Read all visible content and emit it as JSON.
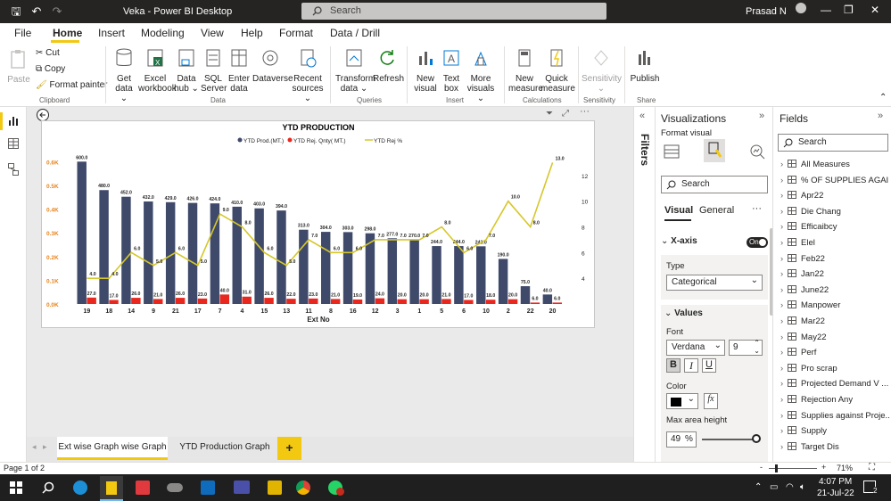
{
  "titlebar": {
    "app_title": "Veka - Power BI Desktop",
    "search_placeholder": "Search",
    "user": "Prasad N"
  },
  "menu": {
    "items": [
      "File",
      "Home",
      "Insert",
      "Modeling",
      "View",
      "Help",
      "Format",
      "Data / Drill"
    ]
  },
  "ribbon": {
    "clipboard": {
      "paste": "Paste",
      "cut": "Cut",
      "copy": "Copy",
      "format_painter": "Format painter",
      "label": "Clipboard"
    },
    "data": {
      "get_data": [
        "Get",
        "data ⌄"
      ],
      "excel": [
        "Excel",
        "workbook"
      ],
      "data_hub": [
        "Data",
        "hub ⌄"
      ],
      "sql": [
        "SQL",
        "Server"
      ],
      "enter": [
        "Enter",
        "data"
      ],
      "dataverse": [
        "Dataverse",
        ""
      ],
      "recent": [
        "Recent",
        "sources ⌄"
      ],
      "label": "Data"
    },
    "queries": {
      "transform": [
        "Transform",
        "data ⌄"
      ],
      "refresh": [
        "Refresh",
        ""
      ],
      "label": "Queries"
    },
    "insert": {
      "new_visual": [
        "New",
        "visual"
      ],
      "text_box": [
        "Text",
        "box"
      ],
      "more_visuals": [
        "More",
        "visuals ⌄"
      ],
      "label": "Insert"
    },
    "calculations": {
      "new_measure": [
        "New",
        "measure"
      ],
      "quick_measure": [
        "Quick",
        "measure"
      ],
      "label": "Calculations"
    },
    "sensitivity": {
      "btn": [
        "Sensitivity",
        "⌄"
      ],
      "label": "Sensitivity"
    },
    "share": {
      "publish": [
        "Publish",
        ""
      ],
      "label": "Share"
    }
  },
  "filters_label": "Filters",
  "viz": {
    "title": "Visualizations",
    "format_visual": "Format visual",
    "search_placeholder": "Search",
    "tab_visual": "Visual",
    "tab_general": "General",
    "more": "···",
    "xaxis": "X-axis",
    "toggle": "On",
    "type_label": "Type",
    "type_value": "Categorical",
    "values_label": "Values",
    "font_label": "Font",
    "font_value": "Verdana",
    "font_size": "9",
    "bold": "B",
    "italic": "I",
    "underline": "U",
    "color_label": "Color",
    "fx": "fx",
    "max_area_label": "Max area height",
    "max_area_value": "49",
    "max_area_unit": "%",
    "max_area_level": 0.49
  },
  "fields": {
    "title": "Fields",
    "search_placeholder": "Search",
    "items": [
      "All Measures",
      "% OF SUPPLIES AGAI...",
      "Apr22",
      "Die Chang",
      "Efficaibcy",
      "Elel",
      "Feb22",
      "Jan22",
      "June22",
      "Manpower",
      "Mar22",
      "May22",
      "Perf",
      "Pro scrap",
      "Projected Demand V ...",
      "Rejection Any",
      "Supplies against Proje...",
      "Supply",
      "Target Dis"
    ]
  },
  "tabs": {
    "items": [
      "Ext wise Graph wise Graph",
      "YTD Production Graph"
    ],
    "add": "+"
  },
  "status": {
    "page": "Page 1 of 2",
    "zoom": "71%",
    "minus": "-",
    "plus": "+"
  },
  "taskbar": {
    "time": "4:07 PM",
    "date": "21-Jul-22",
    "notif": "2"
  },
  "colors": {
    "bar_prod": "#3f4a6b",
    "bar_rej": "#e8281f",
    "line": "#d6c72a",
    "accent": "#f2c811",
    "left_axis": "#e8821c"
  },
  "chart_data": {
    "type": "bar",
    "title": "YTD PRODUCTION",
    "xlabel": "Ext No",
    "legend": [
      "YTD Prod.(MT.)",
      "YTD Rej. Qnty( MT.)",
      "YTD Rej %"
    ],
    "legend_position": "top-center",
    "categories": [
      "19",
      "18",
      "14",
      "9",
      "21",
      "17",
      "7",
      "4",
      "15",
      "13",
      "11",
      "8",
      "16",
      "12",
      "3",
      "1",
      "5",
      "6",
      "10",
      "2",
      "22",
      "20"
    ],
    "series": [
      {
        "name": "YTD Prod.(MT.)",
        "values": [
          600,
          480,
          452,
          432,
          429,
          426,
          424,
          410,
          403,
          394,
          313,
          304,
          303,
          298,
          277,
          270,
          244,
          244,
          243,
          190,
          75,
          40
        ],
        "labels": [
          "600.0",
          "480.0",
          "452.0",
          "432.0",
          "429.0",
          "426.0",
          "424.0",
          "410.0",
          "403.0",
          "394.0",
          "313.0",
          "304.0",
          "303.0",
          "298.0",
          "277.0",
          "270.0",
          "244.0",
          "244.0",
          "243.0",
          "190.0",
          "75.0",
          "40.0"
        ]
      },
      {
        "name": "YTD Rej. Qnty( MT.)",
        "values": [
          27,
          17,
          26,
          21,
          26,
          23,
          40,
          31,
          26,
          22,
          23,
          21,
          19,
          24,
          20,
          20,
          21,
          17,
          18,
          20,
          6,
          6
        ],
        "labels": [
          "27.0",
          "17.0",
          "26.0",
          "21.0",
          "26.0",
          "23.0",
          "40.0",
          "31.0",
          "26.0",
          "22.0",
          "23.0",
          "21.0",
          "19.0",
          "24.0",
          "20.0",
          "20.0",
          "21.0",
          "17.0",
          "18.0",
          "20.0",
          "6.0",
          "6.0"
        ]
      },
      {
        "name": "YTD Rej %",
        "values": [
          4,
          4,
          6,
          5,
          6,
          5,
          9,
          8,
          6,
          5,
          7,
          6,
          6,
          7,
          7,
          7,
          8,
          6,
          7,
          10,
          8,
          13
        ],
        "labels": [
          "4.0",
          "4.0",
          "6.0",
          "5.0",
          "6.0",
          "5.0",
          "9.0",
          "8.0",
          "6.0",
          "5.0",
          "7.0",
          "6.0",
          "6.0",
          "7.0",
          "7.0",
          "7.0",
          "8.0",
          "6.0",
          "7.0",
          "10.0",
          "8.0",
          "13.0"
        ]
      }
    ],
    "yticks_left": [
      "0.0K",
      "0.1K",
      "0.2K",
      "0.3K",
      "0.4K",
      "0.5K",
      "0.6K"
    ],
    "ylim_left": [
      0,
      650
    ],
    "yticks_right": [
      "4",
      "6",
      "8",
      "10",
      "12"
    ],
    "ylim_right": [
      2,
      14
    ]
  }
}
